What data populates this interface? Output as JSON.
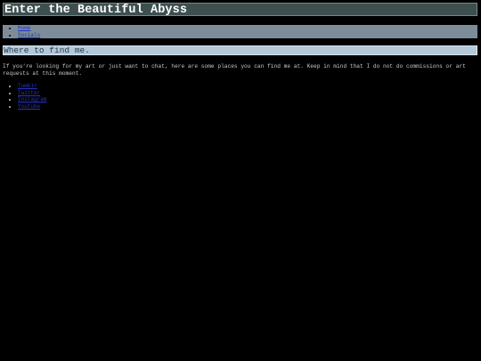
{
  "header": {
    "title": "Enter the Beautiful Abyss"
  },
  "nav": {
    "items": [
      {
        "label": "Home"
      },
      {
        "label": "Socials"
      }
    ]
  },
  "main": {
    "heading": "Where to find me.",
    "intro": "If you're looking for my art or just want to chat, here are some places you can find me at. Keep in mind that I do not do commissions or art requests at this moment.",
    "links": [
      {
        "label": "Tumblr"
      },
      {
        "label": "Twitter"
      },
      {
        "label": "Instagram"
      },
      {
        "label": "Youtube"
      }
    ]
  },
  "colors": {
    "page_background": "#000000",
    "header_background": "#3d4f4f",
    "nav_background": "#7c8d99",
    "section_background": "#b4c8d8",
    "link": "#2a34c0",
    "body_text": "#c8c8c8"
  }
}
